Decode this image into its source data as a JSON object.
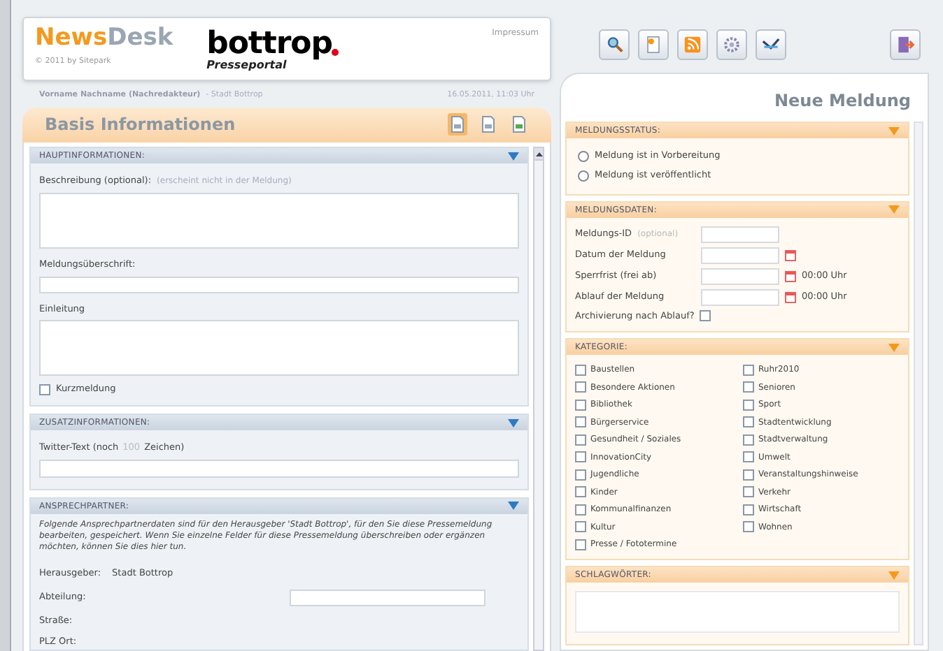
{
  "header": {
    "brand_news": "News",
    "brand_desk": "Desk",
    "copyright": "© 2011 by Sitepark",
    "logo_text": "bottrop",
    "logo_sub": "Presseportal",
    "impressum": "Impressum"
  },
  "user_line": {
    "user": "Vorname Nachname (Nachredakteur)",
    "org": "- Stadt Bottrop",
    "datetime": "16.05.2011, 11:03 Uhr"
  },
  "left_panel": {
    "title": "Basis Informationen",
    "tabs": [
      {
        "selected": true
      },
      {
        "selected": false
      },
      {
        "selected": false
      }
    ],
    "haupt": {
      "title": "HAUPTINFORMATIONEN:",
      "beschreibung_label": "Beschreibung (optional):",
      "beschreibung_hint": "(erscheint nicht in der Meldung)",
      "ueberschrift_label": "Meldungsüberschrift:",
      "einleitung_label": "Einleitung",
      "kurz_label": "Kurzmeldung",
      "kurz_checked": false
    },
    "zusatz": {
      "title": "ZUSATZINFORMATIONEN:",
      "twitter_before": "Twitter-Text (noch",
      "twitter_count": "100",
      "twitter_after": "Zeichen)"
    },
    "ansprech": {
      "title": "ANSPRECHPARTNER:",
      "intro": "Folgende Ansprechpartnerdaten sind für den Herausgeber 'Stadt Bottrop', für den Sie diese Pressemeldung bearbeiten, gespeichert. Wenn Sie einzelne Felder für diese Pressemeldung überschreiben oder ergänzen möchten, können Sie dies hier tun.",
      "herausgeber_label": "Herausgeber:",
      "herausgeber_value": "Stadt Bottrop",
      "abteilung_label": "Abteilung:",
      "strasse_label": "Straße:",
      "plz_label": "PLZ Ort:"
    }
  },
  "right_panel": {
    "title": "Neue Meldung",
    "status": {
      "title": "MELDUNGSSTATUS:",
      "options": [
        {
          "label": "Meldung ist in Vorbereitung",
          "selected": false
        },
        {
          "label": "Meldung ist veröffentlicht",
          "selected": false
        }
      ]
    },
    "daten": {
      "title": "MELDUNGSDATEN:",
      "rows": [
        {
          "label": "Meldungs-ID",
          "hint": "(optional)",
          "calendar": false
        },
        {
          "label": "Datum der Meldung",
          "calendar": true
        },
        {
          "label": "Sperrfrist (frei ab)",
          "calendar": true,
          "time": "00:00 Uhr"
        },
        {
          "label": "Ablauf der Meldung",
          "calendar": true,
          "time": "00:00 Uhr"
        }
      ],
      "archiv_label": "Archivierung nach Ablauf?",
      "archiv_checked": false
    },
    "kategorie": {
      "title": "KATEGORIE:",
      "columns": [
        [
          {
            "label": "Baustellen",
            "checked": false
          },
          {
            "label": "Besondere Aktionen",
            "checked": false
          },
          {
            "label": "Bibliothek",
            "checked": false
          },
          {
            "label": "Bürgerservice",
            "checked": false
          },
          {
            "label": "Gesundheit / Soziales",
            "checked": false
          },
          {
            "label": "InnovationCity",
            "checked": false
          },
          {
            "label": "Jugendliche",
            "checked": false
          },
          {
            "label": "Kinder",
            "checked": false
          },
          {
            "label": "Kommunalfinanzen",
            "checked": false
          },
          {
            "label": "Kultur",
            "checked": false
          },
          {
            "label": "Presse / Fototermine",
            "checked": false
          }
        ],
        [
          {
            "label": "Ruhr2010",
            "checked": false
          },
          {
            "label": "Senioren",
            "checked": false
          },
          {
            "label": "Sport",
            "checked": false
          },
          {
            "label": "Stadtentwicklung",
            "checked": false
          },
          {
            "label": "Stadtverwaltung",
            "checked": false
          },
          {
            "label": "Umwelt",
            "checked": false
          },
          {
            "label": "Veranstaltungshinweise",
            "checked": false
          },
          {
            "label": "Verkehr",
            "checked": false
          },
          {
            "label": "Wirtschaft",
            "checked": false
          },
          {
            "label": "Wohnen",
            "checked": false
          }
        ]
      ]
    },
    "schlagwoerter": {
      "title": "SCHLAGWÖRTER:"
    }
  }
}
